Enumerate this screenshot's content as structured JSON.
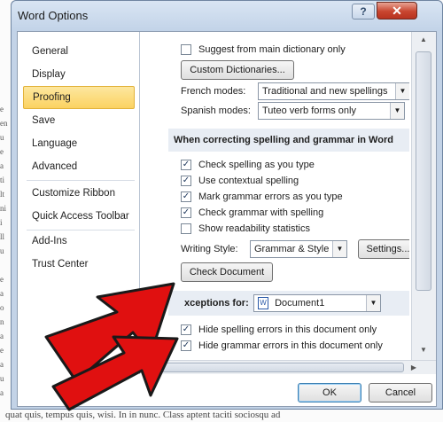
{
  "dialog": {
    "title": "Word Options",
    "help_label": "?",
    "close_label": "✕"
  },
  "nav": {
    "items": [
      {
        "label": "General"
      },
      {
        "label": "Display"
      },
      {
        "label": "Proofing",
        "active": true
      },
      {
        "label": "Save"
      },
      {
        "label": "Language"
      },
      {
        "label": "Advanced"
      },
      {
        "label": "Customize Ribbon"
      },
      {
        "label": "Quick Access Toolbar"
      },
      {
        "label": "Add-Ins"
      },
      {
        "label": "Trust Center"
      }
    ]
  },
  "proofing": {
    "suggest_main_dictionary": {
      "label": "Suggest from main dictionary only",
      "checked": false
    },
    "custom_dictionaries_label": "Custom Dictionaries...",
    "french_modes": {
      "label": "French modes:",
      "value": "Traditional and new spellings"
    },
    "spanish_modes": {
      "label": "Spanish modes:",
      "value": "Tuteo verb forms only"
    },
    "section_title": "When correcting spelling and grammar in Word",
    "options": [
      {
        "label": "Check spelling as you type",
        "checked": true
      },
      {
        "label": "Use contextual spelling",
        "checked": true
      },
      {
        "label": "Mark grammar errors as you type",
        "checked": true
      },
      {
        "label": "Check grammar with spelling",
        "checked": true
      },
      {
        "label": "Show readability statistics",
        "checked": false
      }
    ],
    "writing_style": {
      "label": "Writing Style:",
      "value": "Grammar & Style"
    },
    "settings_label": "Settings...",
    "check_document_label": "Check Document",
    "exceptions": {
      "label": "xceptions for:",
      "document": "Document1",
      "hide_spelling": {
        "label": "Hide spelling errors in this document only",
        "checked": true
      },
      "hide_grammar": {
        "label": "Hide grammar errors in this document only",
        "checked": true
      }
    }
  },
  "footer": {
    "ok_label": "OK",
    "cancel_label": "Cancel"
  },
  "background_doc": {
    "bottom_text": "quat quis, tempus quis, wisi. In in nunc. Class aptent taciti sociosqu ad"
  },
  "colors": {
    "arrow_red": "#e01010",
    "arrow_outline": "#1a1a1a",
    "nav_active": "#fbd261"
  }
}
